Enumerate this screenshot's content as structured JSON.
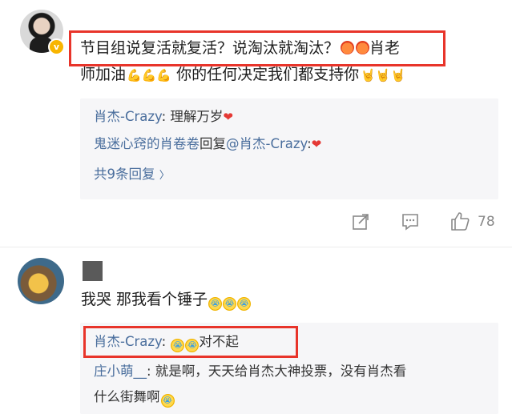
{
  "post": {
    "line1": "节目组说复活就复活？说淘汰就淘汰？",
    "line1_tail": "肖老",
    "line2": "师加油",
    "line2_b": "你的任何决定我们都支持你",
    "badge": "v"
  },
  "replies": [
    {
      "user": "肖杰-Crazy",
      "sep": ":",
      "text": " 理解万岁"
    },
    {
      "user": "鬼迷心窍的肖卷卷",
      "mid": "回复",
      "mention": "@肖杰-Crazy",
      "sep": ":"
    }
  ],
  "more_replies": "共9条回复",
  "more_chevron": "〉",
  "actions": {
    "like_count": "78"
  },
  "comment2": {
    "text": "我哭 那我看个锤子"
  },
  "replies2": [
    {
      "user": "肖杰-Crazy",
      "sep": ":",
      "text": "对不起"
    },
    {
      "user": "庄小萌__",
      "sep": ":",
      "text": " 就是啊，天天给肖杰大神投票，没有肖杰看",
      "text2": "什么街舞啊"
    }
  ],
  "colors": {
    "highlight": "#e8342a",
    "link": "#4a6e9d",
    "reply_bg": "#f6f6f8"
  },
  "icons": [
    "share-icon",
    "comment-icon",
    "like-icon",
    "verified-badge-icon"
  ]
}
